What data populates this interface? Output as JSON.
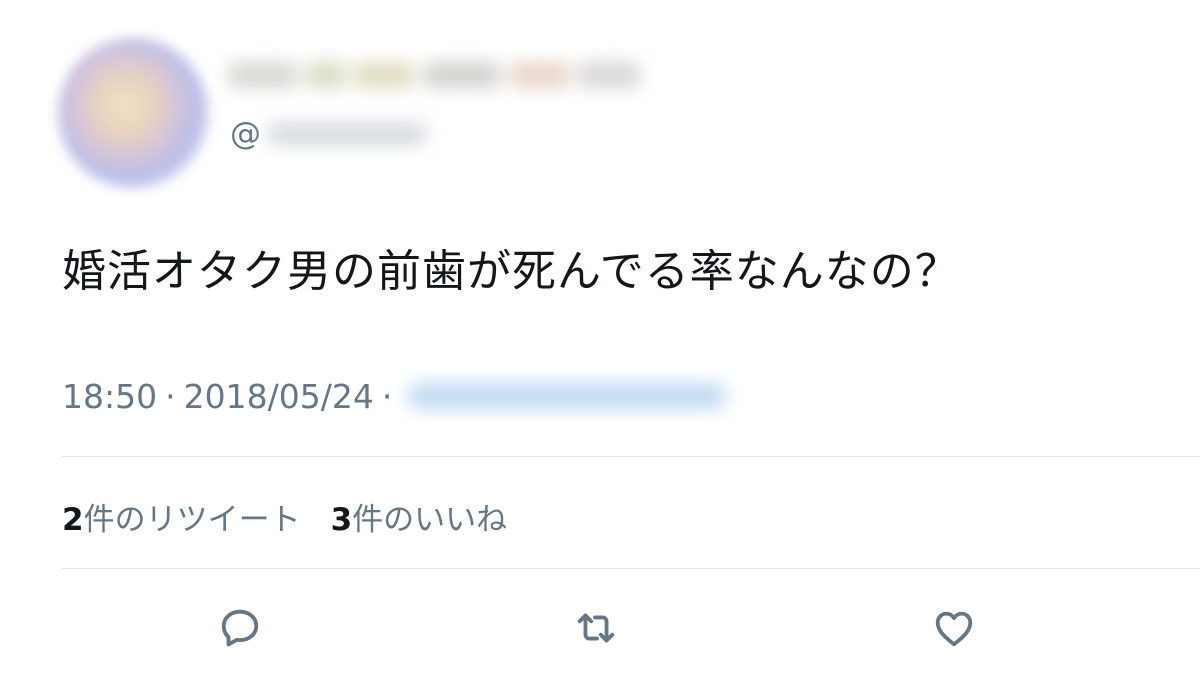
{
  "tweet": {
    "handle_prefix": "@",
    "text": "婚活オタク男の前歯が死んでる率なんなの？",
    "time": "18:50",
    "separator": "·",
    "date": "2018/05/24",
    "separator2": "·"
  },
  "stats": {
    "retweets_count": "2",
    "retweets_label": "件のリツイート",
    "likes_count": "3",
    "likes_label": "件のいいね"
  },
  "actions": {
    "reply_icon": "reply-icon",
    "retweet_icon": "retweet-icon",
    "like_icon": "heart-icon"
  },
  "colors": {
    "text": "#14171a",
    "secondary": "#657786",
    "divider": "#e1e8ed"
  }
}
